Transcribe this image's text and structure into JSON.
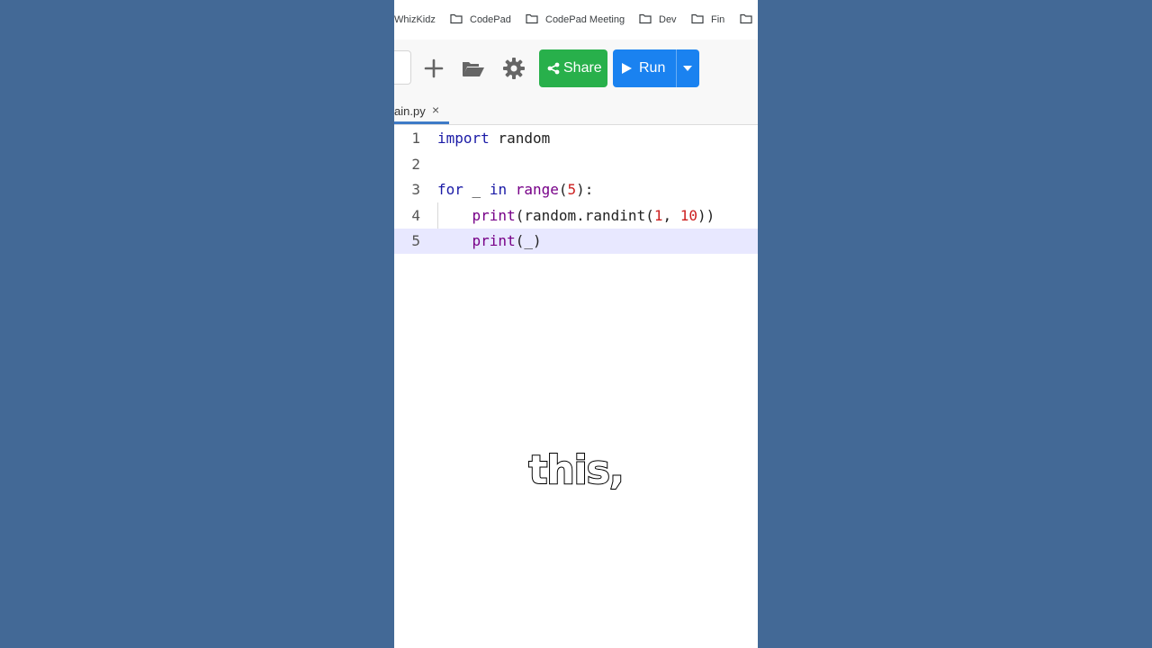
{
  "bookmarks": [
    {
      "label": "WhizKidz",
      "icon": "none"
    },
    {
      "label": "CodePad",
      "icon": "folder-icon"
    },
    {
      "label": "CodePad Meeting",
      "icon": "folder-icon"
    },
    {
      "label": "Dev",
      "icon": "folder-icon"
    },
    {
      "label": "Fin",
      "icon": "folder-icon"
    }
  ],
  "toolbar": {
    "share_label": "Share",
    "run_label": "Run",
    "icons": [
      "plus-icon",
      "folder-open-icon",
      "gear-icon",
      "share-icon",
      "play-icon",
      "caret-down-icon"
    ]
  },
  "tabs": [
    {
      "label": "ain.py",
      "close": "×",
      "active": true
    }
  ],
  "editor": {
    "active_line": 5,
    "lines": [
      {
        "num": "1",
        "tokens": [
          {
            "t": "import",
            "c": "kw"
          },
          {
            "t": " random",
            "c": ""
          }
        ]
      },
      {
        "num": "2",
        "tokens": []
      },
      {
        "num": "3",
        "tokens": [
          {
            "t": "for",
            "c": "kw"
          },
          {
            "t": " _ ",
            "c": ""
          },
          {
            "t": "in",
            "c": "kw"
          },
          {
            "t": " ",
            "c": ""
          },
          {
            "t": "range",
            "c": "kw2"
          },
          {
            "t": "(",
            "c": ""
          },
          {
            "t": "5",
            "c": "num"
          },
          {
            "t": "):",
            "c": ""
          }
        ]
      },
      {
        "num": "4",
        "tokens": [
          {
            "t": "    ",
            "c": ""
          },
          {
            "t": "print",
            "c": "kw2"
          },
          {
            "t": "(random.randint(",
            "c": ""
          },
          {
            "t": "1",
            "c": "num"
          },
          {
            "t": ", ",
            "c": ""
          },
          {
            "t": "10",
            "c": "num"
          },
          {
            "t": "))",
            "c": ""
          }
        ]
      },
      {
        "num": "5",
        "tokens": [
          {
            "t": "    ",
            "c": ""
          },
          {
            "t": "print",
            "c": "kw2"
          },
          {
            "t": "(_)",
            "c": ""
          }
        ]
      }
    ]
  },
  "caption": "this,",
  "colors": {
    "background": "#436996",
    "share": "#28b04b",
    "run": "#1a82f0",
    "keyword": "#1a1aa6",
    "builtin": "#770088",
    "number": "#cc1f1f",
    "active_line": "#e8e8ff"
  }
}
